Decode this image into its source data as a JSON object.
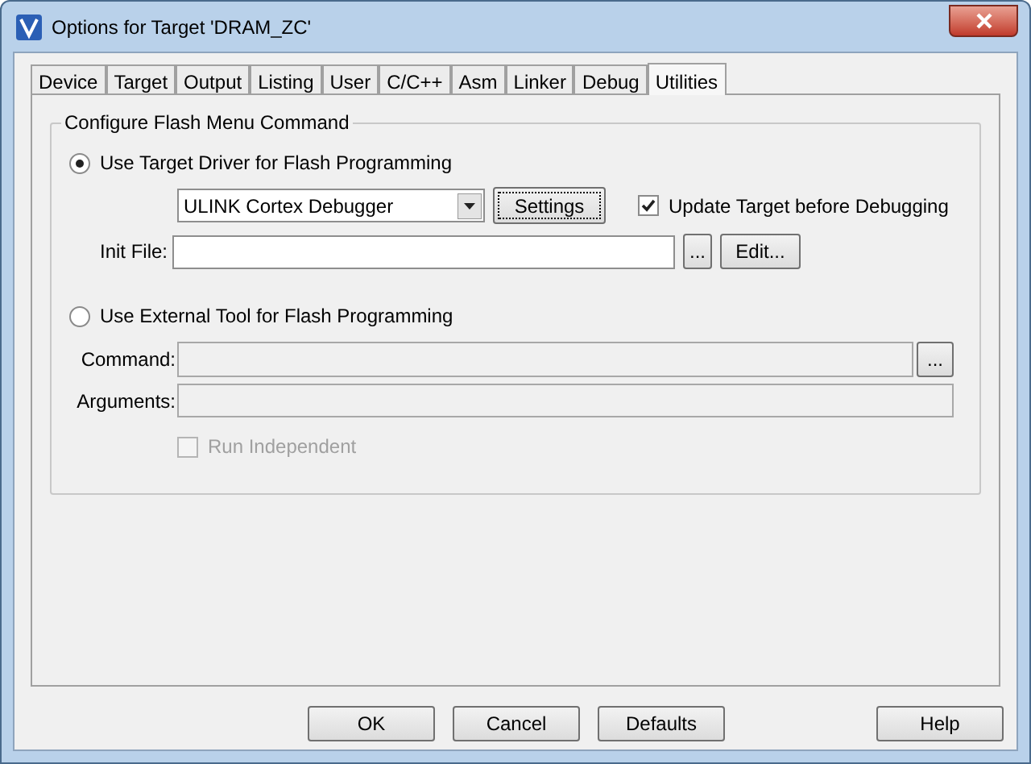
{
  "window": {
    "title": "Options for Target 'DRAM_ZC'"
  },
  "tabs": [
    {
      "label": "Device",
      "selected": false
    },
    {
      "label": "Target",
      "selected": false
    },
    {
      "label": "Output",
      "selected": false
    },
    {
      "label": "Listing",
      "selected": false
    },
    {
      "label": "User",
      "selected": false
    },
    {
      "label": "C/C++",
      "selected": false
    },
    {
      "label": "Asm",
      "selected": false
    },
    {
      "label": "Linker",
      "selected": false
    },
    {
      "label": "Debug",
      "selected": false
    },
    {
      "label": "Utilities",
      "selected": true
    }
  ],
  "group": {
    "title": "Configure Flash Menu Command"
  },
  "target_driver": {
    "label": "Use Target Driver for Flash Programming",
    "selected": true,
    "driver": {
      "value": "ULINK Cortex Debugger"
    },
    "settings_button": "Settings",
    "update_target": {
      "label": "Update Target before Debugging",
      "checked": true
    },
    "init_file": {
      "label": "Init File:",
      "browse_button": "...",
      "edit_button": "Edit..."
    }
  },
  "external_tool": {
    "label": "Use External Tool for Flash Programming",
    "selected": false,
    "command": {
      "label": "Command:",
      "disabled": true,
      "browse_button": "..."
    },
    "arguments": {
      "label": "Arguments:",
      "disabled": true
    },
    "run_independent": {
      "label": "Run Independent",
      "checked": false,
      "disabled": true
    }
  },
  "buttons": [
    "OK",
    "Cancel",
    "Defaults",
    "Help"
  ]
}
